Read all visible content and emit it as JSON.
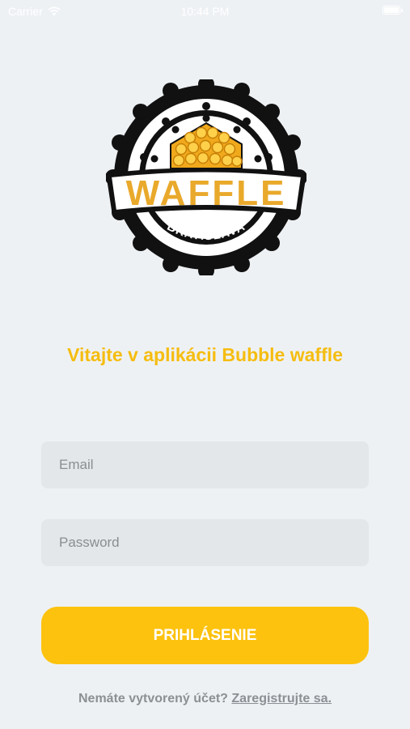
{
  "status_bar": {
    "carrier": "Carrier",
    "time": "10:44 PM"
  },
  "logo": {
    "brand": "WAFFLE",
    "city": "BRATISLAVA"
  },
  "welcome_text": "Vitajte v aplikácii Bubble waffle",
  "form": {
    "email_placeholder": "Email",
    "password_placeholder": "Password",
    "login_label": "PRIHLÁSENIE"
  },
  "register": {
    "prompt": "Nemáte vytvorený účet?",
    "link": "Zaregistrujte sa."
  },
  "colors": {
    "accent": "#fcc20e",
    "title": "#f5bd10",
    "background": "#eef1f4",
    "field": "#e4e7ea"
  }
}
